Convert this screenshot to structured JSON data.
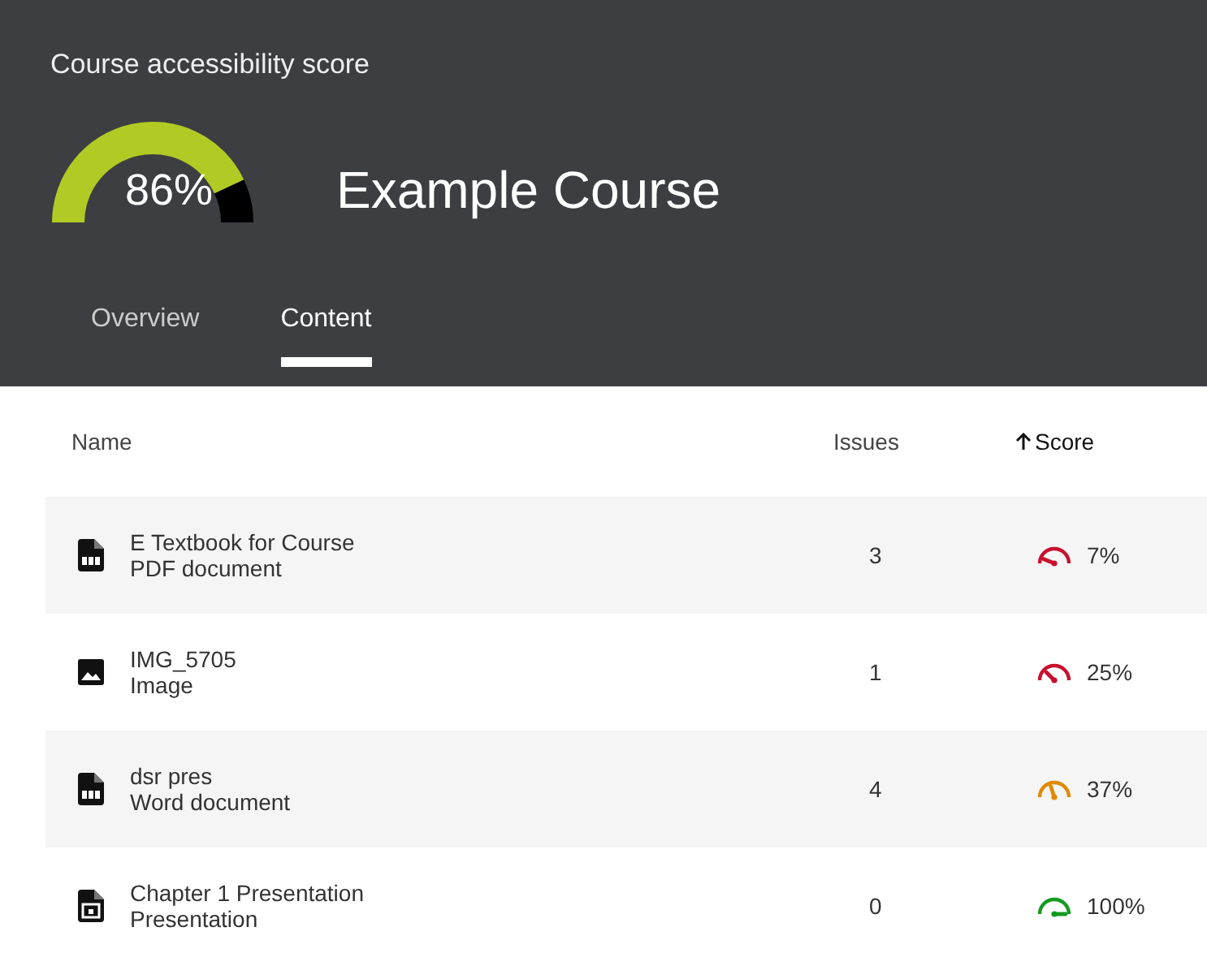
{
  "header": {
    "caption": "Course accessibility score",
    "gauge": {
      "reading": "86%"
    },
    "title": "Example Course"
  },
  "tabs": [
    {
      "label": "Overview",
      "selected": false
    },
    {
      "label": "Content",
      "selected": true
    }
  ],
  "table": {
    "columns": [
      {
        "label": "Name",
        "sorted": false
      },
      {
        "label": "Issues",
        "sorted": false
      },
      {
        "label": "Score",
        "sorted": true
      }
    ],
    "rows": [
      {
        "kind": "pdf",
        "name": "E Textbook for Course",
        "type": "PDF document",
        "issues": "3",
        "score": "7%",
        "color": "#c8102e"
      },
      {
        "kind": "image",
        "name": "IMG_5705",
        "type": "Image",
        "issues": "1",
        "score": "25%",
        "color": "#c8102e"
      },
      {
        "kind": "doc",
        "name": "dsr pres",
        "type": "Word document",
        "issues": "4",
        "score": "37%",
        "color": "#e08a00"
      },
      {
        "kind": "slides",
        "name": "Chapter 1 Presentation",
        "type": "Presentation",
        "issues": "0",
        "score": "100%",
        "color": "#139b1e"
      }
    ]
  }
}
